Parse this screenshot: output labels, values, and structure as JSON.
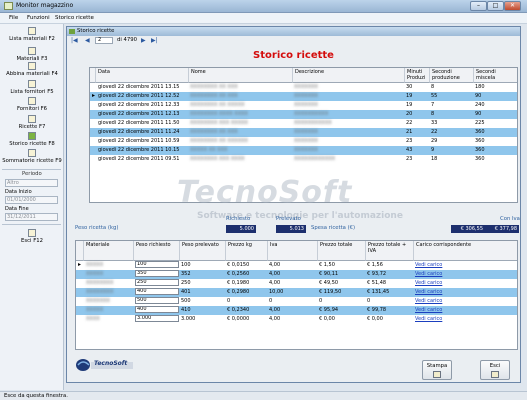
{
  "window": {
    "title": "Monitor magazzino",
    "min": "–",
    "max": "□",
    "close": "✕"
  },
  "menu": [
    "File",
    "Funzioni",
    "Storico ricette"
  ],
  "sidebar": {
    "items": [
      {
        "label": "Lista materiali F2"
      },
      {
        "label": "Materiali F3"
      },
      {
        "label": "Abbina materiali F4"
      },
      {
        "label": "Lista fornitori F5"
      },
      {
        "label": "Fornitori F6"
      },
      {
        "label": "Ricette F7"
      },
      {
        "label": "Storico ricette F8"
      },
      {
        "label": "Sommatorie ricette F9"
      }
    ],
    "period_title": "Periodo",
    "period_value": "Altro",
    "start_label": "Data Inizio",
    "start_value": "01/01/2000",
    "end_label": "Data Fine",
    "end_value": "31/12/2011",
    "exit_label": "Esci F12"
  },
  "child": {
    "title": "Storico ricette",
    "nav": {
      "first": "|◀",
      "prev": "◀",
      "page": "2",
      "of": "di 4790",
      "next": "▶",
      "last": "▶|"
    },
    "heading": "Storico ricette",
    "grid1": {
      "headers": [
        "Data",
        "Nome",
        "Descrizione",
        "Minuti Produzi",
        "Secondi produzione",
        "Secondi miscela"
      ],
      "rows": [
        {
          "data": "giovedì 22 dicembre 2011 13.15",
          "nome": "XXXXXXXX XX XXX",
          "desc": "XXXXXXX",
          "min": "30",
          "sp": "8",
          "sm": "180"
        },
        {
          "data": "giovedì 22 dicembre 2011 12.52",
          "nome": "XXXXXXXX XX XXX",
          "desc": "XXXXXXX",
          "min": "19",
          "sp": "55",
          "sm": "90"
        },
        {
          "data": "giovedì 22 dicembre 2011 12.33",
          "nome": "XXXXXXXX XX XXXXX",
          "desc": "XXXXXXX",
          "min": "19",
          "sp": "7",
          "sm": "240"
        },
        {
          "data": "giovedì 22 dicembre 2011 12.13",
          "nome": "XXXXXXXX XXXX XXXX",
          "desc": "XXXXXXXXXX",
          "min": "20",
          "sp": "8",
          "sm": "90"
        },
        {
          "data": "giovedì 22 dicembre 2011 11.50",
          "nome": "XXXXXXXX XXX XXXXX",
          "desc": "XXXXXXXXXXX",
          "min": "22",
          "sp": "33",
          "sm": "225"
        },
        {
          "data": "giovedì 22 dicembre 2011 11.24",
          "nome": "XXXXXXXX XX XXX",
          "desc": "XXXXXXX",
          "min": "21",
          "sp": "22",
          "sm": "360"
        },
        {
          "data": "giovedì 22 dicembre 2011 10.59",
          "nome": "XXXXXXXX XX XXXXXX",
          "desc": "XXXXXXX",
          "min": "23",
          "sp": "29",
          "sm": "360"
        },
        {
          "data": "giovedì 22 dicembre 2011 10.15",
          "nome": "XXXXX XX XXX",
          "desc": "XXXXXXX",
          "min": "43",
          "sp": "9",
          "sm": "360"
        },
        {
          "data": "giovedì 22 dicembre 2011 09.51",
          "nome": "XXXXXXXX XXX XXXX",
          "desc": "XXXXXXXXXXXX",
          "min": "23",
          "sp": "18",
          "sm": "360"
        }
      ]
    },
    "watermark": "TecnoSoft",
    "watermark_sub": "Software e tecnologie per l'automazione",
    "summary": {
      "richiesto_label": "Richiesto",
      "prelevato_label": "Prelevato",
      "con_iva_label": "Con Iva",
      "peso_label": "Peso ricetta (kg)",
      "peso_richiesto": "5.000",
      "peso_prelevato": "5.013",
      "spesa_label": "Spesa ricetta (€)",
      "spesa_netto": "€ 306,55",
      "spesa_iva": "€ 377,98"
    },
    "grid2": {
      "headers": [
        "Materiale",
        "Peso richiesto",
        "Peso prelevato",
        "Prezzo kg",
        "Iva",
        "Prezzo totale",
        "Prezzo totale + IVA",
        "Carico corrispondente"
      ],
      "rows": [
        {
          "mat": "XXXXX",
          "pr": "100",
          "pp": "100",
          "kg": "€ 0,0150",
          "iva": "4,00",
          "tot": "€ 1,50",
          "totiva": "€ 1,56",
          "link": "Vedi carico"
        },
        {
          "mat": "XXXXX",
          "pr": "350",
          "pp": "352",
          "kg": "€ 0,2560",
          "iva": "4,00",
          "tot": "€ 90,11",
          "totiva": "€ 93,72",
          "link": "Vedi carico"
        },
        {
          "mat": "XXXXXXXX",
          "pr": "250",
          "pp": "250",
          "kg": "€ 0,1980",
          "iva": "4,00",
          "tot": "€ 49,50",
          "totiva": "€ 51,48",
          "link": "Vedi carico"
        },
        {
          "mat": "XXXXXXXX",
          "pr": "400",
          "pp": "401",
          "kg": "€ 0,2980",
          "iva": "10,00",
          "tot": "€ 119,50",
          "totiva": "€ 131,45",
          "link": "Vedi carico"
        },
        {
          "mat": "XXXXXXX",
          "pr": "500",
          "pp": "500",
          "kg": "0",
          "iva": "0",
          "tot": "0",
          "totiva": "0",
          "link": "Vedi carico"
        },
        {
          "mat": "XXXXX",
          "pr": "400",
          "pp": "410",
          "kg": "€ 0,2340",
          "iva": "4,00",
          "tot": "€ 95,94",
          "totiva": "€ 99,78",
          "link": "Vedi carico"
        },
        {
          "mat": "XXXX",
          "pr": "3.000",
          "pp": "3.000",
          "kg": "€ 0,0000",
          "iva": "4,00",
          "tot": "€ 0,00",
          "totiva": "€ 0,00",
          "link": "Vedi carico"
        }
      ]
    },
    "logo_text": "TecnoSoft",
    "buttons": {
      "print": "Stampa",
      "exit": "Esci"
    }
  },
  "status": "Esce da questa finestra."
}
